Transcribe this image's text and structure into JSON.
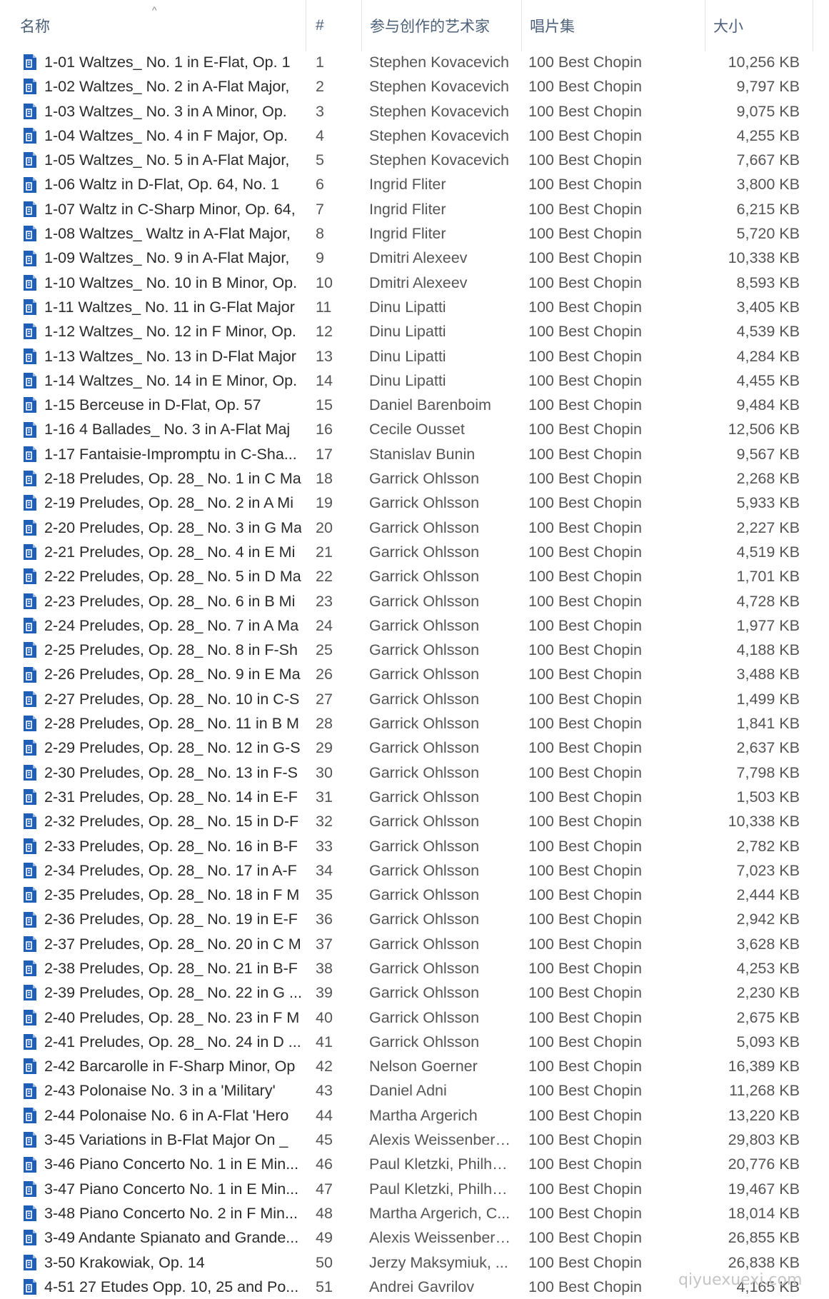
{
  "header": {
    "columns": {
      "name": "名称",
      "num": "#",
      "artist": "参与创作的艺术家",
      "album": "唱片集",
      "size": "大小"
    },
    "sort_indicator": "^"
  },
  "file_icon": "audio-file-icon",
  "colors": {
    "icon": "#1f5fb8",
    "header_text": "#4c607a"
  },
  "rows": [
    {
      "name": "1-01 Waltzes_ No. 1 in E-Flat, Op. 1",
      "num": "1",
      "artist": "Stephen Kovacevich",
      "album": "100 Best Chopin",
      "size": "10,256 KB"
    },
    {
      "name": "1-02 Waltzes_ No. 2 in A-Flat Major,",
      "num": "2",
      "artist": "Stephen Kovacevich",
      "album": "100 Best Chopin",
      "size": "9,797 KB"
    },
    {
      "name": "1-03 Waltzes_ No. 3 in A Minor, Op.",
      "num": "3",
      "artist": "Stephen Kovacevich",
      "album": "100 Best Chopin",
      "size": "9,075 KB"
    },
    {
      "name": "1-04 Waltzes_ No. 4 in F Major, Op.",
      "num": "4",
      "artist": "Stephen Kovacevich",
      "album": "100 Best Chopin",
      "size": "4,255 KB"
    },
    {
      "name": "1-05 Waltzes_ No. 5 in A-Flat Major,",
      "num": "5",
      "artist": "Stephen Kovacevich",
      "album": "100 Best Chopin",
      "size": "7,667 KB"
    },
    {
      "name": "1-06 Waltz in D-Flat, Op. 64, No. 1",
      "num": "6",
      "artist": "Ingrid Fliter",
      "album": "100 Best Chopin",
      "size": "3,800 KB"
    },
    {
      "name": "1-07 Waltz in C-Sharp Minor, Op. 64,",
      "num": "7",
      "artist": "Ingrid Fliter",
      "album": "100 Best Chopin",
      "size": "6,215 KB"
    },
    {
      "name": "1-08 Waltzes_ Waltz in A-Flat Major,",
      "num": "8",
      "artist": "Ingrid Fliter",
      "album": "100 Best Chopin",
      "size": "5,720 KB"
    },
    {
      "name": "1-09 Waltzes_ No. 9 in A-Flat Major,",
      "num": "9",
      "artist": "Dmitri Alexeev",
      "album": "100 Best Chopin",
      "size": "10,338 KB"
    },
    {
      "name": "1-10 Waltzes_ No. 10 in B Minor, Op.",
      "num": "10",
      "artist": "Dmitri Alexeev",
      "album": "100 Best Chopin",
      "size": "8,593 KB"
    },
    {
      "name": "1-11 Waltzes_ No. 11 in G-Flat Major",
      "num": "11",
      "artist": "Dinu Lipatti",
      "album": "100 Best Chopin",
      "size": "3,405 KB"
    },
    {
      "name": "1-12 Waltzes_ No. 12 in F Minor, Op.",
      "num": "12",
      "artist": "Dinu Lipatti",
      "album": "100 Best Chopin",
      "size": "4,539 KB"
    },
    {
      "name": "1-13 Waltzes_ No. 13 in D-Flat Major",
      "num": "13",
      "artist": "Dinu Lipatti",
      "album": "100 Best Chopin",
      "size": "4,284 KB"
    },
    {
      "name": "1-14 Waltzes_ No. 14 in E Minor, Op.",
      "num": "14",
      "artist": "Dinu Lipatti",
      "album": "100 Best Chopin",
      "size": "4,455 KB"
    },
    {
      "name": "1-15 Berceuse in D-Flat, Op. 57",
      "num": "15",
      "artist": "Daniel Barenboim",
      "album": "100 Best Chopin",
      "size": "9,484 KB"
    },
    {
      "name": "1-16 4 Ballades_ No. 3 in A-Flat Maj",
      "num": "16",
      "artist": "Cecile Ousset",
      "album": "100 Best Chopin",
      "size": "12,506 KB"
    },
    {
      "name": "1-17 Fantaisie-Impromptu in C-Sha...",
      "num": "17",
      "artist": "Stanislav Bunin",
      "album": "100 Best Chopin",
      "size": "9,567 KB"
    },
    {
      "name": "2-18 Preludes, Op. 28_ No. 1 in C Ma",
      "num": "18",
      "artist": "Garrick Ohlsson",
      "album": "100 Best Chopin",
      "size": "2,268 KB"
    },
    {
      "name": "2-19 Preludes, Op. 28_ No. 2 in A Mi",
      "num": "19",
      "artist": "Garrick Ohlsson",
      "album": "100 Best Chopin",
      "size": "5,933 KB"
    },
    {
      "name": "2-20 Preludes, Op. 28_ No. 3 in G Ma",
      "num": "20",
      "artist": "Garrick Ohlsson",
      "album": "100 Best Chopin",
      "size": "2,227 KB"
    },
    {
      "name": "2-21 Preludes, Op. 28_ No. 4 in E Mi",
      "num": "21",
      "artist": "Garrick Ohlsson",
      "album": "100 Best Chopin",
      "size": "4,519 KB"
    },
    {
      "name": "2-22 Preludes, Op. 28_ No. 5 in D Ma",
      "num": "22",
      "artist": "Garrick Ohlsson",
      "album": "100 Best Chopin",
      "size": "1,701 KB"
    },
    {
      "name": "2-23 Preludes, Op. 28_ No. 6 in B Mi",
      "num": "23",
      "artist": "Garrick Ohlsson",
      "album": "100 Best Chopin",
      "size": "4,728 KB"
    },
    {
      "name": "2-24 Preludes, Op. 28_ No. 7 in A Ma",
      "num": "24",
      "artist": "Garrick Ohlsson",
      "album": "100 Best Chopin",
      "size": "1,977 KB"
    },
    {
      "name": "2-25 Preludes, Op. 28_ No. 8 in F-Sh",
      "num": "25",
      "artist": "Garrick Ohlsson",
      "album": "100 Best Chopin",
      "size": "4,188 KB"
    },
    {
      "name": "2-26 Preludes, Op. 28_ No. 9 in E Ma",
      "num": "26",
      "artist": "Garrick Ohlsson",
      "album": "100 Best Chopin",
      "size": "3,488 KB"
    },
    {
      "name": "2-27 Preludes, Op. 28_ No. 10 in C-S",
      "num": "27",
      "artist": "Garrick Ohlsson",
      "album": "100 Best Chopin",
      "size": "1,499 KB"
    },
    {
      "name": "2-28 Preludes, Op. 28_ No. 11 in B M",
      "num": "28",
      "artist": "Garrick Ohlsson",
      "album": "100 Best Chopin",
      "size": "1,841 KB"
    },
    {
      "name": "2-29 Preludes, Op. 28_ No. 12 in G-S",
      "num": "29",
      "artist": "Garrick Ohlsson",
      "album": "100 Best Chopin",
      "size": "2,637 KB"
    },
    {
      "name": "2-30 Preludes, Op. 28_ No. 13 in F-S",
      "num": "30",
      "artist": "Garrick Ohlsson",
      "album": "100 Best Chopin",
      "size": "7,798 KB"
    },
    {
      "name": "2-31 Preludes, Op. 28_ No. 14 in E-F",
      "num": "31",
      "artist": "Garrick Ohlsson",
      "album": "100 Best Chopin",
      "size": "1,503 KB"
    },
    {
      "name": "2-32 Preludes, Op. 28_ No. 15 in D-F",
      "num": "32",
      "artist": "Garrick Ohlsson",
      "album": "100 Best Chopin",
      "size": "10,338 KB"
    },
    {
      "name": "2-33 Preludes, Op. 28_ No. 16 in B-F",
      "num": "33",
      "artist": "Garrick Ohlsson",
      "album": "100 Best Chopin",
      "size": "2,782 KB"
    },
    {
      "name": "2-34 Preludes, Op. 28_ No. 17 in A-F",
      "num": "34",
      "artist": "Garrick Ohlsson",
      "album": "100 Best Chopin",
      "size": "7,023 KB"
    },
    {
      "name": "2-35 Preludes, Op. 28_ No. 18 in F M",
      "num": "35",
      "artist": "Garrick Ohlsson",
      "album": "100 Best Chopin",
      "size": "2,444 KB"
    },
    {
      "name": "2-36 Preludes, Op. 28_ No. 19 in E-F",
      "num": "36",
      "artist": "Garrick Ohlsson",
      "album": "100 Best Chopin",
      "size": "2,942 KB"
    },
    {
      "name": "2-37 Preludes, Op. 28_ No. 20 in C M",
      "num": "37",
      "artist": "Garrick Ohlsson",
      "album": "100 Best Chopin",
      "size": "3,628 KB"
    },
    {
      "name": "2-38 Preludes, Op. 28_ No. 21 in B-F",
      "num": "38",
      "artist": "Garrick Ohlsson",
      "album": "100 Best Chopin",
      "size": "4,253 KB"
    },
    {
      "name": "2-39 Preludes, Op. 28_ No. 22 in G ...",
      "num": "39",
      "artist": "Garrick Ohlsson",
      "album": "100 Best Chopin",
      "size": "2,230 KB"
    },
    {
      "name": "2-40 Preludes, Op. 28_ No. 23 in F M",
      "num": "40",
      "artist": "Garrick Ohlsson",
      "album": "100 Best Chopin",
      "size": "2,675 KB"
    },
    {
      "name": "2-41 Preludes, Op. 28_ No. 24 in D ...",
      "num": "41",
      "artist": "Garrick Ohlsson",
      "album": "100 Best Chopin",
      "size": "5,093 KB"
    },
    {
      "name": "2-42 Barcarolle in F-Sharp Minor, Op",
      "num": "42",
      "artist": "Nelson Goerner",
      "album": "100 Best Chopin",
      "size": "16,389 KB"
    },
    {
      "name": "2-43 Polonaise No. 3 in a 'Military'",
      "num": "43",
      "artist": "Daniel Adni",
      "album": "100 Best Chopin",
      "size": "11,268 KB"
    },
    {
      "name": "2-44 Polonaise No. 6 in A-Flat 'Hero",
      "num": "44",
      "artist": "Martha Argerich",
      "album": "100 Best Chopin",
      "size": "13,220 KB"
    },
    {
      "name": "3-45 Variations in B-Flat Major On _",
      "num": "45",
      "artist": "Alexis Weissenberg...",
      "album": "100 Best Chopin",
      "size": "29,803 KB"
    },
    {
      "name": "3-46 Piano Concerto No. 1 in E Min...",
      "num": "46",
      "artist": "Paul Kletzki, Philhar...",
      "album": "100 Best Chopin",
      "size": "20,776 KB"
    },
    {
      "name": "3-47 Piano Concerto No. 1 in E Min...",
      "num": "47",
      "artist": "Paul Kletzki, Philhar...",
      "album": "100 Best Chopin",
      "size": "19,467 KB"
    },
    {
      "name": "3-48 Piano Concerto No. 2 in F Min...",
      "num": "48",
      "artist": "Martha Argerich, C...",
      "album": "100 Best Chopin",
      "size": "18,014 KB"
    },
    {
      "name": "3-49 Andante Spianato and Grande...",
      "num": "49",
      "artist": "Alexis Weissenberg...",
      "album": "100 Best Chopin",
      "size": "26,855 KB"
    },
    {
      "name": "3-50 Krakowiak, Op. 14",
      "num": "50",
      "artist": "Jerzy Maksymiuk, ...",
      "album": "100 Best Chopin",
      "size": "26,838 KB"
    },
    {
      "name": "4-51 27 Etudes Opp. 10, 25 and Po...",
      "num": "51",
      "artist": "Andrei Gavrilov",
      "album": "100 Best Chopin",
      "size": "4,165 KB"
    }
  ],
  "watermark": "qiyuexuexi.com"
}
